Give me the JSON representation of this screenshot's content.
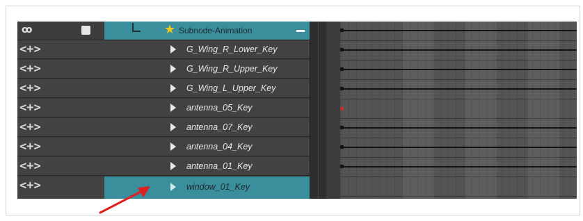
{
  "header": {
    "link_icon": "ꝏ",
    "group_name": "Subnode-Animation"
  },
  "layers": [
    {
      "nav": "<+>",
      "name": "G_Wing_R_Lower_Key",
      "key": "black"
    },
    {
      "nav": "<+>",
      "name": "G_Wing_R_Upper_Key",
      "key": "black"
    },
    {
      "nav": "<+>",
      "name": "G_Wing_L_Upper_Key",
      "key": "black"
    },
    {
      "nav": "<+>",
      "name": "antenna_05_Key",
      "key": "red"
    },
    {
      "nav": "<+>",
      "name": "antenna_07_Key",
      "key": "black"
    },
    {
      "nav": "<+>",
      "name": "antenna_04_Key",
      "key": "black"
    },
    {
      "nav": "<+>",
      "name": "antenna_01_Key",
      "key": "black"
    },
    {
      "nav": "<+>",
      "name": "window_01_Key",
      "key": "none",
      "selected": true
    }
  ],
  "icons": {
    "header_link": "link-icon",
    "group_star": "star-icon",
    "collapse": "minus-icon",
    "expand": "triangle-right-icon",
    "annotation": "red-arrow"
  },
  "colors": {
    "selection": "#3b8e9b",
    "star": "#f2c81f",
    "arrow": "#e02020",
    "key_red": "#c0312f"
  }
}
